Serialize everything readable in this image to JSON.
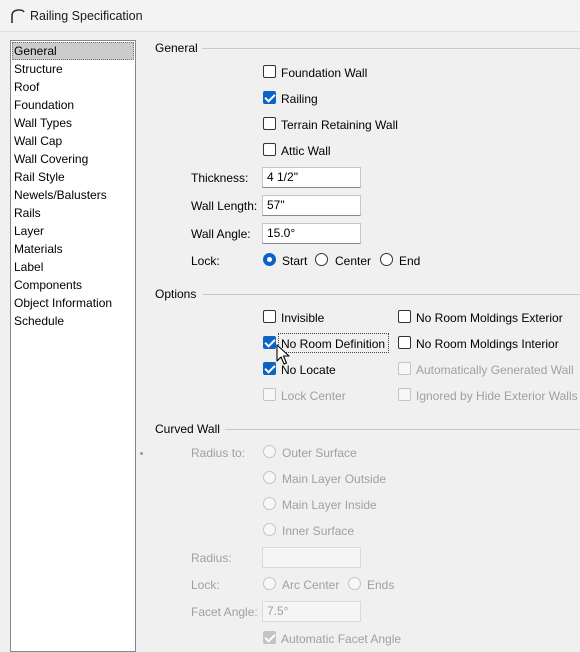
{
  "window": {
    "title": "Railing Specification",
    "icon": "curved-wall-app-icon"
  },
  "nav": {
    "items": [
      "General",
      "Structure",
      "Roof",
      "Foundation",
      "Wall Types",
      "Wall Cap",
      "Wall Covering",
      "Rail Style",
      "Newels/Balusters",
      "Rails",
      "Layer",
      "Materials",
      "Label",
      "Components",
      "Object Information",
      "Schedule"
    ],
    "selected": "General"
  },
  "general": {
    "title": "General",
    "foundation_wall": {
      "label": "Foundation Wall",
      "checked": false
    },
    "railing": {
      "label": "Railing",
      "checked": true
    },
    "terrain_retaining_wall": {
      "label": "Terrain Retaining Wall",
      "checked": false
    },
    "attic_wall": {
      "label": "Attic Wall",
      "checked": false
    },
    "thickness": {
      "label": "Thickness:",
      "value": "4 1/2\""
    },
    "wall_length": {
      "label": "Wall Length:",
      "value": "57\""
    },
    "wall_angle": {
      "label": "Wall Angle:",
      "value": "15.0°"
    },
    "lock": {
      "label": "Lock:",
      "options": [
        "Start",
        "Center",
        "End"
      ],
      "selected": "Start"
    }
  },
  "options": {
    "title": "Options",
    "invisible": {
      "label": "Invisible",
      "checked": false
    },
    "no_room_definition": {
      "label": "No Room Definition",
      "checked": true
    },
    "no_locate": {
      "label": "No Locate",
      "checked": true
    },
    "lock_center": {
      "label": "Lock Center",
      "checked": false,
      "disabled": true
    },
    "no_room_moldings_exterior": {
      "label": "No Room Moldings Exterior",
      "checked": false
    },
    "no_room_moldings_interior": {
      "label": "No Room Moldings Interior",
      "checked": false
    },
    "automatically_generated_wall": {
      "label": "Automatically Generated Wall",
      "checked": false,
      "disabled": true
    },
    "ignored_by_hide_exterior_walls": {
      "label": "Ignored by Hide Exterior Walls",
      "checked": false,
      "disabled": true
    }
  },
  "curved_wall": {
    "title": "Curved Wall",
    "radius_to": {
      "label": "Radius to:",
      "options": [
        "Outer Surface",
        "Main Layer Outside",
        "Main Layer Inside",
        "Inner Surface"
      ]
    },
    "radius": {
      "label": "Radius:",
      "value": ""
    },
    "lock": {
      "label": "Lock:",
      "options": [
        "Arc Center",
        "Ends"
      ]
    },
    "facet_angle": {
      "label": "Facet Angle:",
      "value": "7.5°"
    },
    "automatic_facet_angle": {
      "label": "Automatic Facet Angle",
      "checked": true,
      "disabled": true
    }
  },
  "colors": {
    "accent": "#0b63c4",
    "disabled_text": "#a0a0a0",
    "nav_selected": "#cccccc"
  }
}
